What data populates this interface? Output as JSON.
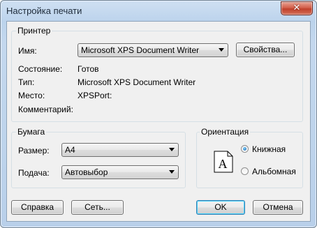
{
  "window": {
    "title": "Настройка печати",
    "close_glyph": "✕"
  },
  "printer": {
    "group_label": "Принтер",
    "name_label": "Имя:",
    "name_value": "Microsoft XPS Document Writer",
    "properties_button": "Свойства...",
    "status_label": "Состояние:",
    "status_value": "Готов",
    "type_label": "Тип:",
    "type_value": "Microsoft XPS Document Writer",
    "where_label": "Место:",
    "where_value": "XPSPort:",
    "comment_label": "Комментарий:"
  },
  "paper": {
    "group_label": "Бумага",
    "size_label": "Размер:",
    "size_value": "A4",
    "source_label": "Подача:",
    "source_value": "Автовыбор"
  },
  "orientation": {
    "group_label": "Ориентация",
    "page_glyph": "A",
    "options": [
      {
        "label": "Книжная",
        "selected": true
      },
      {
        "label": "Альбомная",
        "selected": false
      }
    ]
  },
  "buttons": {
    "help": "Справка",
    "network": "Сеть...",
    "ok": "OK",
    "cancel": "Отмена"
  }
}
